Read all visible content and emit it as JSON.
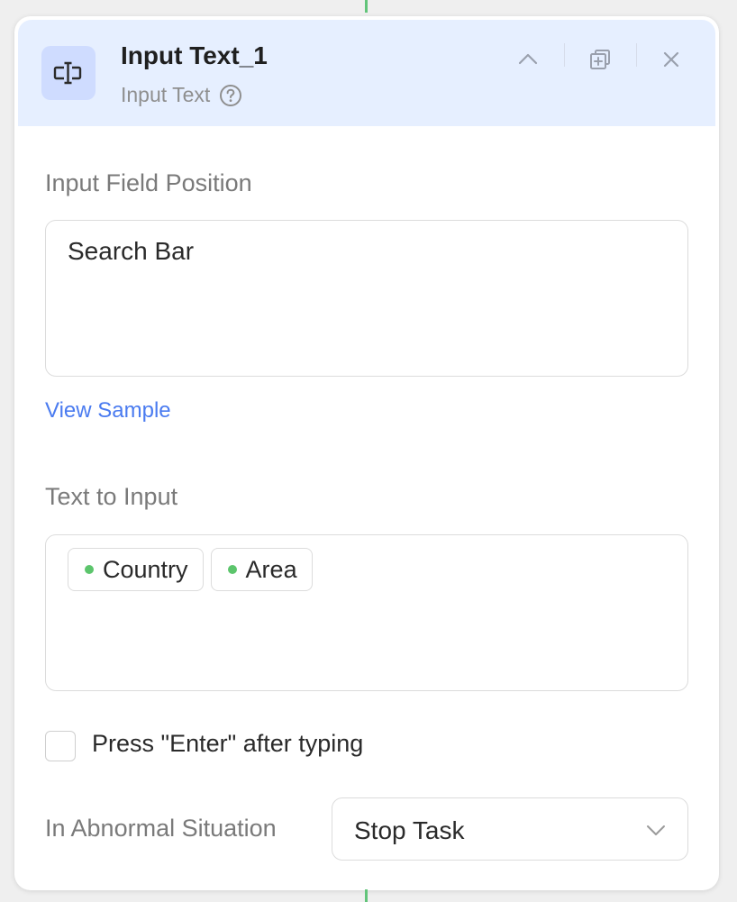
{
  "node": {
    "title": "Input Text_1",
    "subtitle": "Input Text",
    "icon": "input-text-icon",
    "accent": "#4a7bf0",
    "header_bg": "#e6efff"
  },
  "input_position": {
    "label": "Input Field Position",
    "value": "Search Bar",
    "link": "View Sample"
  },
  "text_to_input": {
    "label": "Text to Input",
    "chips": [
      "Country",
      "Area"
    ],
    "chip_dot_color": "#5cc56c"
  },
  "enter_option": {
    "label": "Press \"Enter\" after typing",
    "checked": false
  },
  "abnormal": {
    "label": "In Abnormal Situation",
    "value": "Stop Task"
  }
}
